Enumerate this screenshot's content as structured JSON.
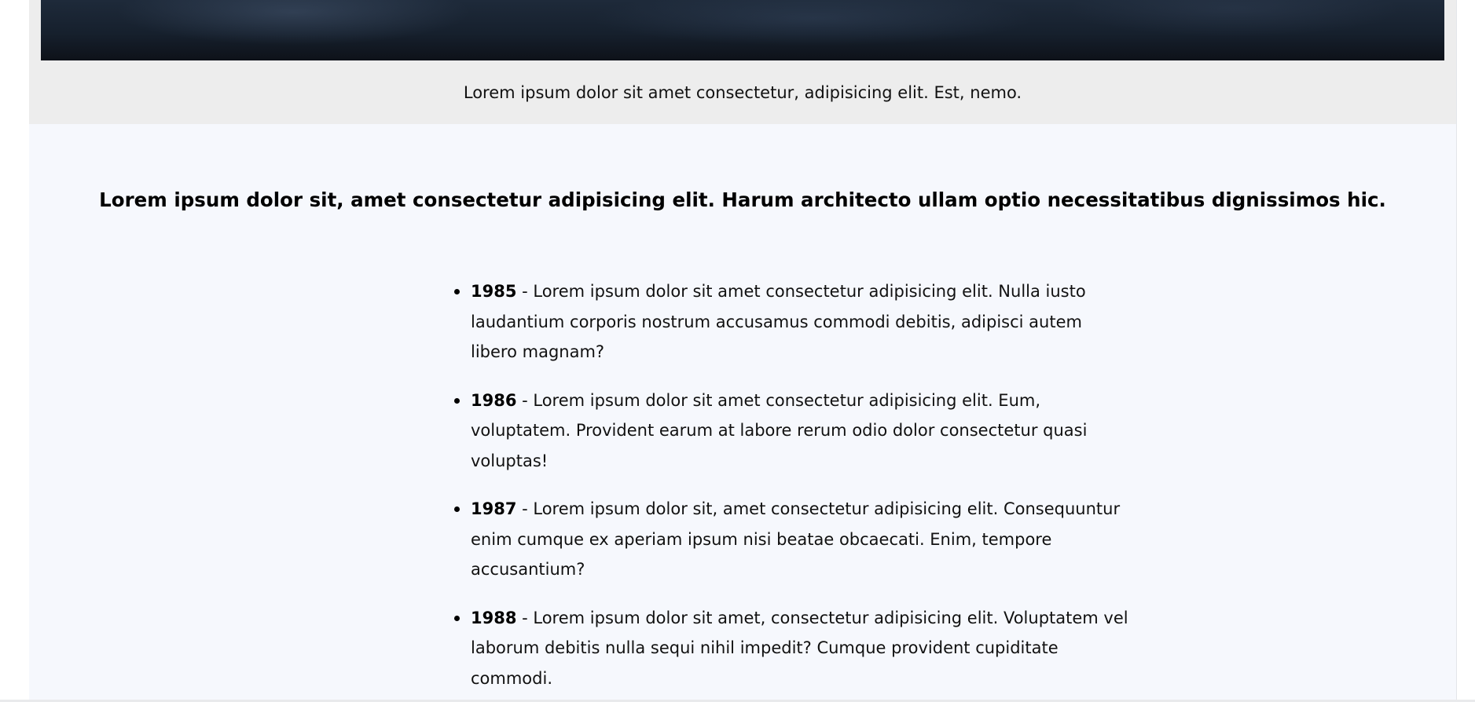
{
  "figure": {
    "caption": "Lorem ipsum dolor sit amet consectetur, adipisicing elit. Est, nemo."
  },
  "article": {
    "lead": "Lorem ipsum dolor sit, amet consectetur adipisicing elit. Harum architecto ullam optio necessitatibus dignissimos hic.",
    "timeline": [
      {
        "year": "1985",
        "text": " - Lorem ipsum dolor sit amet consectetur adipisicing elit. Nulla iusto laudantium corporis nostrum accusamus commodi debitis, adipisci autem libero magnam?"
      },
      {
        "year": "1986",
        "text": " - Lorem ipsum dolor sit amet consectetur adipisicing elit. Eum, voluptatem. Provident earum at labore rerum odio dolor consectetur quasi voluptas!"
      },
      {
        "year": "1987",
        "text": " - Lorem ipsum dolor sit, amet consectetur adipisicing elit. Consequuntur enim cumque ex aperiam ipsum nisi beatae obcaecati. Enim, tempore accusantium?"
      },
      {
        "year": "1988",
        "text": " - Lorem ipsum dolor sit amet, consectetur adipisicing elit. Voluptatem vel laborum debitis nulla sequi nihil impedit? Cumque provident cupiditate commodi."
      }
    ]
  }
}
